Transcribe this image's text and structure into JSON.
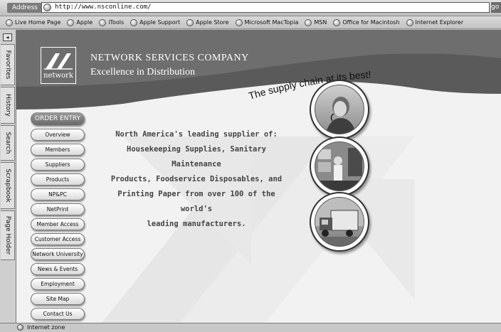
{
  "address_bar": {
    "label": "Address",
    "url": "http://www.nsconline.com/",
    "go_label": "go"
  },
  "favorites": [
    {
      "label": "Live Home Page"
    },
    {
      "label": "Apple"
    },
    {
      "label": "iTools"
    },
    {
      "label": "Apple Support"
    },
    {
      "label": "Apple Store"
    },
    {
      "label": "Microsoft MacTopia"
    },
    {
      "label": "MSN"
    },
    {
      "label": "Office for Macintosh"
    },
    {
      "label": "Internet Explorer"
    }
  ],
  "sidebar": {
    "toggle_icon": "collapse-icon",
    "tabs": [
      {
        "label": "Favorites"
      },
      {
        "label": "History"
      },
      {
        "label": "Search"
      },
      {
        "label": "Scrapbook"
      },
      {
        "label": "Page Holder"
      }
    ]
  },
  "header": {
    "logo_text": "network",
    "company_name": "NETWORK SERVICES COMPANY",
    "tagline": "Excellence in Distribution",
    "slogan": "The supply chain at its best!"
  },
  "nav": {
    "heading": "ORDER ENTRY",
    "items": [
      {
        "label": "Overview"
      },
      {
        "label": "Members"
      },
      {
        "label": "Suppliers"
      },
      {
        "label": "Products"
      },
      {
        "label": "NP&PC"
      },
      {
        "label": "NetPrint"
      },
      {
        "label": "Member Access"
      },
      {
        "label": "Customer Access"
      },
      {
        "label": "Network University"
      },
      {
        "label": "News & Events"
      },
      {
        "label": "Employment"
      },
      {
        "label": "Site Map"
      },
      {
        "label": "Contact Us"
      }
    ]
  },
  "main": {
    "blurb_lines": [
      "North America's leading supplier of:",
      "Housekeeping Supplies, Sanitary Maintenance",
      "Products, Foodservice Disposables, and",
      "Printing Paper from over 100 of the world's",
      "leading manufacturers."
    ]
  },
  "status_bar": {
    "text": "Internet zone"
  }
}
